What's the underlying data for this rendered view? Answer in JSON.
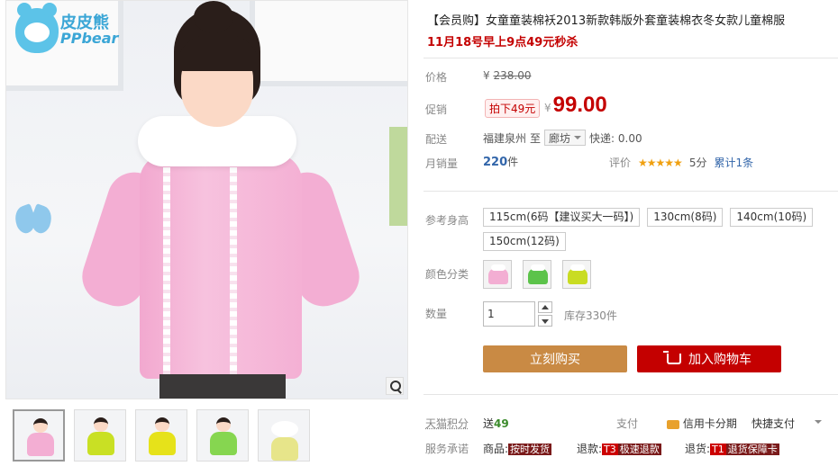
{
  "brand": {
    "name_cn": "皮皮熊",
    "name_en": "PPbear"
  },
  "product": {
    "title": "【会员购】女童童装棉袄2013新款韩版外套童装棉衣冬女款儿童棉服",
    "subtitle": "11月18号早上9点49元秒杀"
  },
  "price": {
    "label": "价格",
    "currency": "¥",
    "original": "238.00"
  },
  "promo": {
    "label": "促销",
    "tag": "拍下49元",
    "currency": "¥",
    "price": "99.00"
  },
  "shipping": {
    "label": "配送",
    "from": "福建泉州",
    "to_word": "至",
    "destination": "廊坊",
    "express": "快递: 0.00"
  },
  "monthly_sales": {
    "label": "月销量",
    "count": "220",
    "unit": "件"
  },
  "rating": {
    "label": "评价",
    "stars": "★★★★★",
    "score": "5分",
    "reviews": "累计1条"
  },
  "size": {
    "label": "参考身高",
    "options": [
      "115cm(6码【建议买大一码】)",
      "130cm(8码)",
      "140cm(10码)",
      "150cm(12码)"
    ]
  },
  "color": {
    "label": "颜色分类",
    "options": [
      "pink",
      "green",
      "yellow"
    ]
  },
  "quantity": {
    "label": "数量",
    "value": "1",
    "stock": "库存330件"
  },
  "buttons": {
    "buy_now": "立刻购买",
    "add_to_cart": "加入购物车"
  },
  "points": {
    "label": "天猫积分",
    "give": "送",
    "amount": "49"
  },
  "payment": {
    "label": "支付",
    "credit": "信用卡分期",
    "fast": "快捷支付"
  },
  "service": {
    "label": "服务承诺",
    "goods": "商品:",
    "goods_badge": "按时发货",
    "refund": "退款:",
    "refund_t": "T3",
    "refund_badge": "极速退款",
    "return": "退货:",
    "return_t": "T1",
    "return_badge": "退货保障卡"
  },
  "thumbnails": [
    "pink",
    "green",
    "yellow",
    "green-alt",
    "white-fur"
  ],
  "colors": {
    "accent_red": "#c40000",
    "buy_button": "#c98a44",
    "link_blue": "#3366aa",
    "star": "#f0a010"
  }
}
